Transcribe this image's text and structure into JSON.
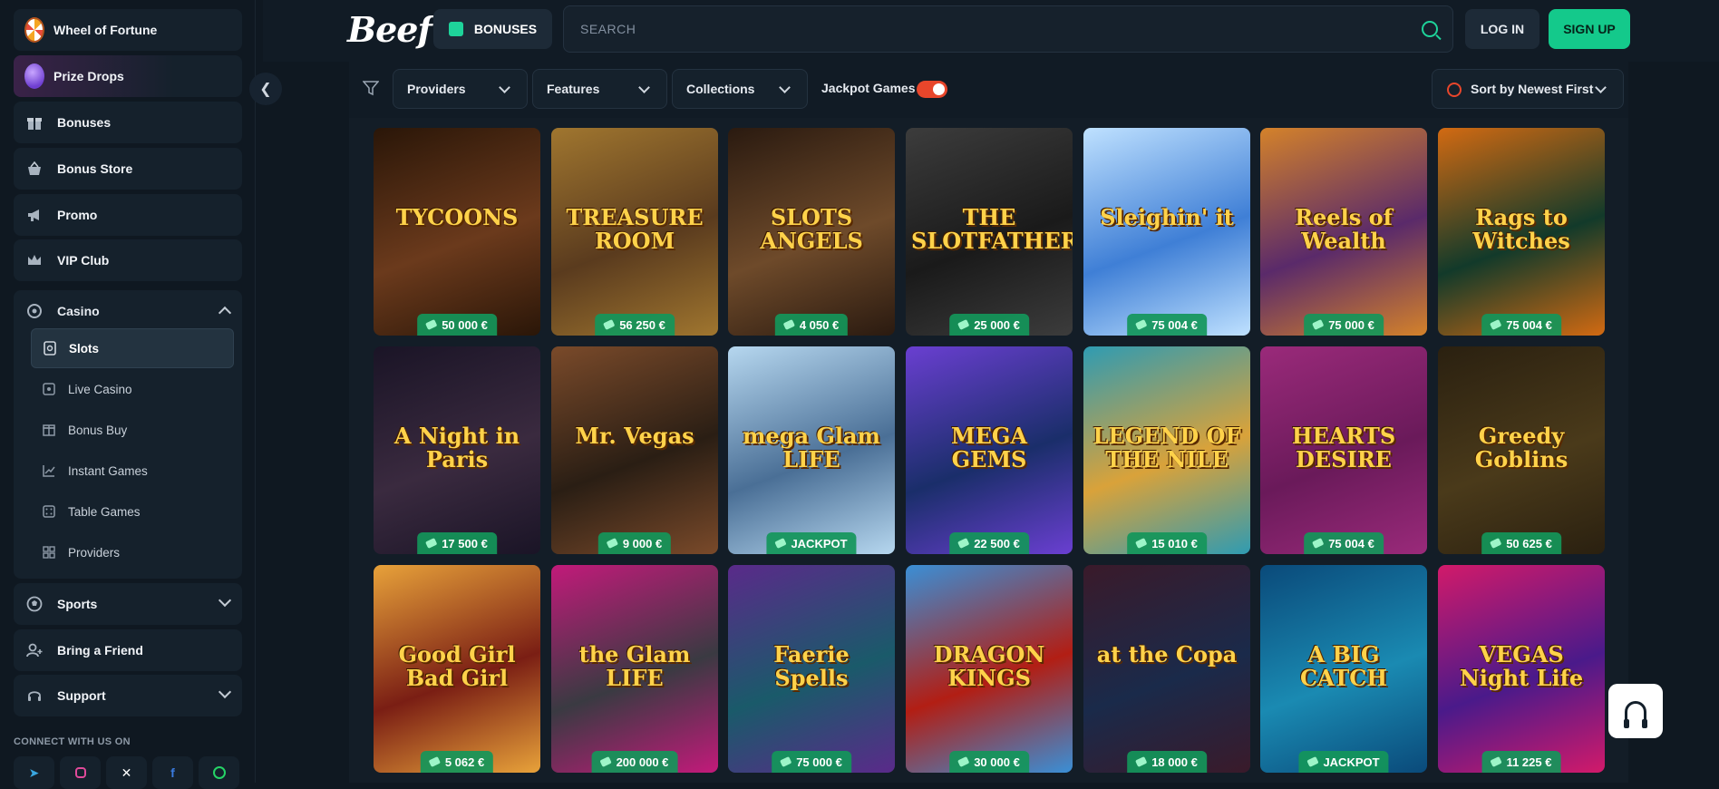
{
  "header": {
    "logo": "Beef",
    "bonuses_label": "BONUSES",
    "search_placeholder": "SEARCH",
    "login_label": "LOG IN",
    "signup_label": "SIGN UP"
  },
  "sidebar": {
    "items": [
      {
        "label": "Wheel of Fortune",
        "icon": "wheel-icon"
      },
      {
        "label": "Prize Drops",
        "icon": "prize-drop-icon"
      },
      {
        "label": "Bonuses",
        "icon": "gift-icon"
      },
      {
        "label": "Bonus Store",
        "icon": "basket-icon"
      },
      {
        "label": "Promo",
        "icon": "megaphone-icon"
      },
      {
        "label": "VIP Club",
        "icon": "crown-icon"
      }
    ],
    "casino": {
      "label": "Casino",
      "sub": [
        {
          "label": "Slots",
          "icon": "slot-icon",
          "active": true
        },
        {
          "label": "Live Casino",
          "icon": "live-icon"
        },
        {
          "label": "Bonus Buy",
          "icon": "bonus-buy-icon"
        },
        {
          "label": "Instant Games",
          "icon": "chart-icon"
        },
        {
          "label": "Table Games",
          "icon": "dice-icon"
        },
        {
          "label": "Providers",
          "icon": "grid-icon"
        }
      ]
    },
    "sports": "Sports",
    "bring_friend": "Bring a Friend",
    "support": "Support",
    "connect": "CONNECT WITH US ON",
    "socials": [
      "telegram-icon",
      "instagram-icon",
      "x-icon",
      "facebook-icon",
      "whatsapp-icon"
    ]
  },
  "filters": {
    "providers": "Providers",
    "features": "Features",
    "collections": "Collections",
    "jackpot_label": "Jackpot Games",
    "jackpot_on": true,
    "sort": "Sort by Newest First"
  },
  "games": [
    {
      "title": "TYCOONS",
      "badge": "50 000 €",
      "bg": "#6b3a1c",
      "accent": "#2a1608"
    },
    {
      "title": "TREASURE ROOM",
      "badge": "56 250 €",
      "bg": "#5a3b1e",
      "accent": "#a0762f"
    },
    {
      "title": "SLOTS ANGELS",
      "badge": "4 050 €",
      "bg": "#6e4a2a",
      "accent": "#2a1a10"
    },
    {
      "title": "THE SLOTFATHER",
      "badge": "25 000 €",
      "bg": "#1a1a1a",
      "accent": "#3c3c3c"
    },
    {
      "title": "Sleighin' it",
      "badge": "75 004 €",
      "bg": "#3f7fd6",
      "accent": "#bfe1ff"
    },
    {
      "title": "Reels of Wealth",
      "badge": "75 000 €",
      "bg": "#5a2a6a",
      "accent": "#d4822a"
    },
    {
      "title": "Rags to Witches",
      "badge": "75 004 €",
      "bg": "#123a2a",
      "accent": "#d26a12"
    },
    {
      "title": "A Night in Paris",
      "badge": "17 500 €",
      "bg": "#3a2a3f",
      "accent": "#1a1426"
    },
    {
      "title": "Mr. Vegas",
      "badge": "9 000 €",
      "bg": "#2a1e14",
      "accent": "#7a4a2a"
    },
    {
      "title": "mega Glam LIFE",
      "badge": "JACKPOT",
      "bg": "#4a6f96",
      "accent": "#b6d7ef"
    },
    {
      "title": "MEGA GEMS",
      "badge": "22 500 €",
      "bg": "#1a2e6a",
      "accent": "#6a3fd1"
    },
    {
      "title": "LEGEND OF THE NILE",
      "badge": "15 010 €",
      "bg": "#d9a23a",
      "accent": "#2f9bb2"
    },
    {
      "title": "HEARTS DESIRE",
      "badge": "75 004 €",
      "bg": "#6a1a5a",
      "accent": "#9a2a7a"
    },
    {
      "title": "Greedy Goblins",
      "badge": "50 625 €",
      "bg": "#4a3a1a",
      "accent": "#2a2010"
    },
    {
      "title": "Good Girl Bad Girl",
      "badge": "5 062 €",
      "bg": "#7a1e14",
      "accent": "#e8a23a"
    },
    {
      "title": "the Glam LIFE",
      "badge": "200 000 €",
      "bg": "#3a3a42",
      "accent": "#c21a7a"
    },
    {
      "title": "Faerie Spells",
      "badge": "75 000 €",
      "bg": "#1a5a6a",
      "accent": "#5a2a8a"
    },
    {
      "title": "DRAGON KINGS",
      "badge": "30 000 €",
      "bg": "#b21e14",
      "accent": "#3a8fd6"
    },
    {
      "title": "at the Copa",
      "badge": "18 000 €",
      "bg": "#1a2a4a",
      "accent": "#3a1a2a"
    },
    {
      "title": "A BIG CATCH",
      "badge": "JACKPOT",
      "bg": "#1a8ab2",
      "accent": "#0a4a7a"
    },
    {
      "title": "VEGAS Night Life",
      "badge": "11 225 €",
      "bg": "#4a1a8a",
      "accent": "#d21a6a"
    }
  ],
  "support_fab_icon": "headset-icon"
}
